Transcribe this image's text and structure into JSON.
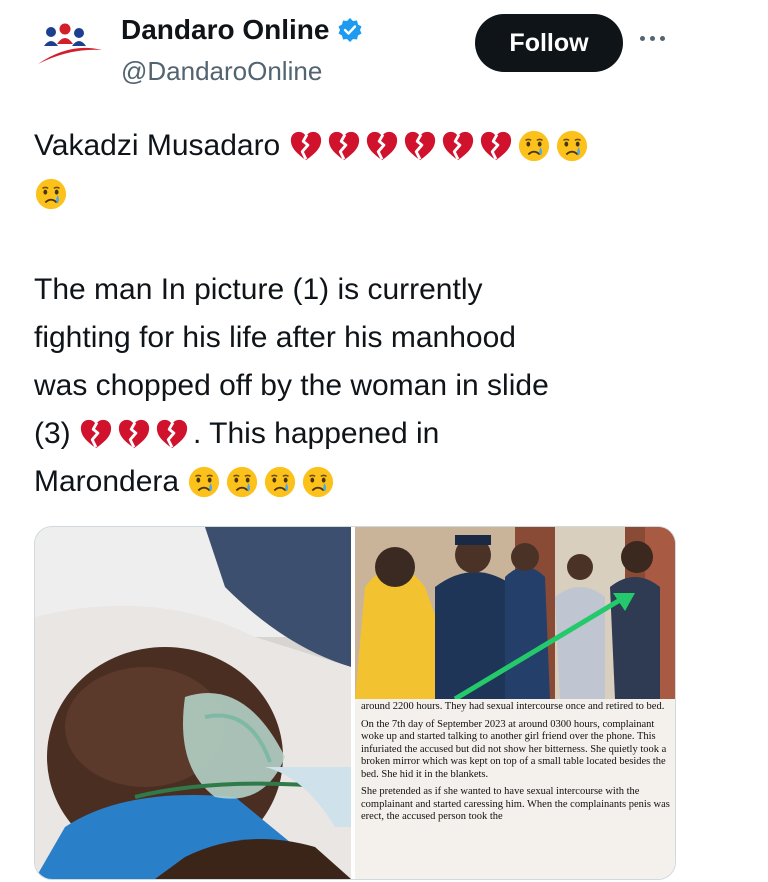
{
  "account": {
    "name": "Dandaro Online",
    "handle": "@DandaroOnline",
    "verified": true,
    "avatar_icon": "dandaro-logo-icon"
  },
  "header": {
    "follow_label": "Follow",
    "more_icon": "more-dots-icon"
  },
  "tweet": {
    "line1_text": "Vakadzi Musadaro",
    "para2_lines": [
      "The man In picture (1) is currently",
      "fighting for his life after his manhood",
      "was chopped off by the woman in slide",
      "(3)",
      ". This happened in",
      "Marondera"
    ],
    "emoji_names": [
      "broken-heart-icon",
      "crying-face-icon"
    ]
  },
  "media": {
    "document_paragraphs": [
      "around 2200 hours. They had sexual intercourse once and retired to bed.",
      "On the 7th day of September 2023 at around 0300 hours, complainant woke up and started talking to another girl friend over the phone. This infuriated the accused but did not show her bitterness. She quietly took a broken mirror which was kept on top of a small table located besides the bed. She hid it in the blankets.",
      "She pretended as if she wanted to have sexual intercourse with the complainant and started caressing him. When the complainants penis was erect, the accused person took the"
    ]
  },
  "colors": {
    "text": "#0f1419",
    "secondary": "#536471",
    "follow_bg": "#0f1419",
    "verified": "#1d9bf0",
    "broken_heart": "#d0122c"
  }
}
